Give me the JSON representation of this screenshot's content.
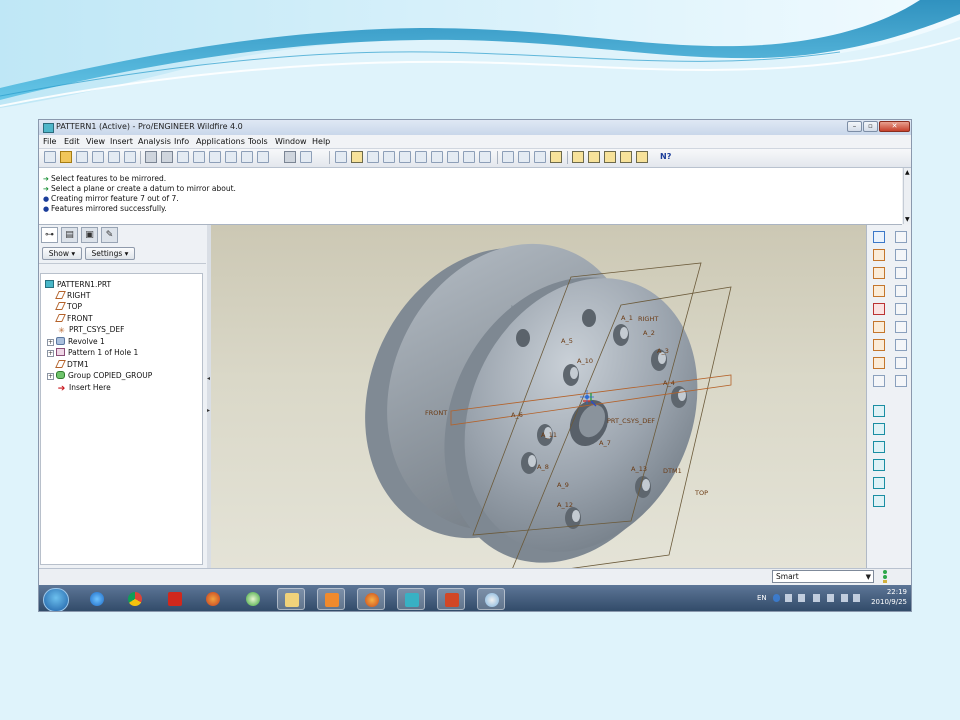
{
  "window": {
    "title": "PATTERN1 (Active) - Pro/ENGINEER Wildfire 4.0",
    "controls": {
      "minimize": "–",
      "maximize": "▫",
      "close": "✕"
    }
  },
  "menu": [
    "File",
    "Edit",
    "View",
    "Insert",
    "Analysis",
    "Info",
    "Applications",
    "Tools",
    "Window",
    "Help"
  ],
  "messages": [
    {
      "type": "prompt",
      "text": "Select features to be mirrored."
    },
    {
      "type": "prompt",
      "text": "Select a plane or create a datum to mirror about."
    },
    {
      "type": "info",
      "text": "Creating mirror feature 7 out of 7."
    },
    {
      "type": "info",
      "text": "Features mirrored successfully."
    }
  ],
  "navigator": {
    "tabs": [
      "model-tree-icon",
      "layer-icon",
      "folder-icon",
      "favorites-icon"
    ],
    "show_button": "Show ▾",
    "settings_button": "Settings ▾",
    "tree": [
      {
        "label": "PATTERN1.PRT",
        "icon": "part-icon",
        "expandable": false,
        "indent": 0
      },
      {
        "label": "RIGHT",
        "icon": "datum-plane-icon",
        "expandable": false,
        "indent": 1
      },
      {
        "label": "TOP",
        "icon": "datum-plane-icon",
        "expandable": false,
        "indent": 1
      },
      {
        "label": "FRONT",
        "icon": "datum-plane-icon",
        "expandable": false,
        "indent": 1
      },
      {
        "label": "PRT_CSYS_DEF",
        "icon": "csys-icon",
        "expandable": false,
        "indent": 1
      },
      {
        "label": "Revolve 1",
        "icon": "revolve-icon",
        "expandable": true,
        "indent": 1
      },
      {
        "label": "Pattern 1 of Hole 1",
        "icon": "pattern-icon",
        "expandable": true,
        "indent": 1
      },
      {
        "label": "DTM1",
        "icon": "datum-plane-icon",
        "expandable": false,
        "indent": 1
      },
      {
        "label": "Group COPIED_GROUP",
        "icon": "group-icon",
        "expandable": true,
        "indent": 1
      },
      {
        "label": "Insert Here",
        "icon": "insert-here-icon",
        "expandable": false,
        "indent": 1
      }
    ]
  },
  "graphics": {
    "datum_labels": [
      "FRONT",
      "RIGHT",
      "TOP",
      "DTM1",
      "PRT_CSYS_DEF"
    ],
    "axis_labels": [
      "A_1",
      "A_2",
      "A_3",
      "A_4",
      "A_5",
      "A_6",
      "A_7",
      "A_8",
      "A_9",
      "A_10",
      "A_11",
      "A_12",
      "A_13"
    ],
    "background_top": "#ccc8b4",
    "background_bottom": "#e4e3d7",
    "part_color": "#9ea7b0"
  },
  "status": {
    "filter": "Smart",
    "filter_options": [
      "Smart"
    ]
  },
  "taskbar": {
    "apps": [
      "ie-icon",
      "chrome-icon",
      "solidworks-icon",
      "firefox-old-icon",
      "media-icon",
      "explorer-folder-icon",
      "media-player-icon",
      "firefox-icon",
      "proe-icon",
      "powerpoint-icon",
      "paint-icon"
    ],
    "lang": "EN",
    "time": "22:19",
    "date": "2010/9/25"
  },
  "colors": {
    "accent": "#3c78c8",
    "datum": "#b4622a",
    "prompt_arrow": "#0f8a2c",
    "info_dot": "#1b3d9a"
  }
}
